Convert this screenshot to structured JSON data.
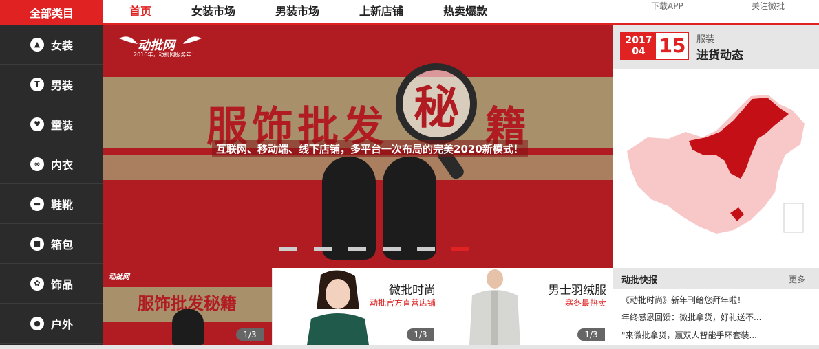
{
  "header": {
    "all_categories": "全部类目",
    "nav": [
      {
        "label": "首页",
        "active": true
      },
      {
        "label": "女装市场",
        "active": false
      },
      {
        "label": "男装市场",
        "active": false
      },
      {
        "label": "上新店铺",
        "active": false
      },
      {
        "label": "热卖爆款",
        "active": false
      }
    ],
    "download_app": "下载APP",
    "follow_weibo": "关注微批"
  },
  "sidebar": {
    "items": [
      {
        "label": "女装",
        "icon": "dress-icon"
      },
      {
        "label": "男装",
        "icon": "shirt-icon"
      },
      {
        "label": "童装",
        "icon": "kids-clothes-icon"
      },
      {
        "label": "内衣",
        "icon": "underwear-icon"
      },
      {
        "label": "鞋靴",
        "icon": "shoe-icon"
      },
      {
        "label": "箱包",
        "icon": "bag-icon"
      },
      {
        "label": "饰品",
        "icon": "accessory-icon"
      },
      {
        "label": "户外",
        "icon": "outdoor-icon"
      }
    ]
  },
  "banner": {
    "logo_text": "动批网",
    "logo_sub": "2016年，动批网服务年！",
    "headline": "服饰批发",
    "headline_magnified": "秘",
    "headline_tail": "籍",
    "subline": "互联网、移动端、线下店铺，多平台一次布局的完美2020新模式！",
    "slide_count": 6,
    "active_slide": 6
  },
  "date_panel": {
    "year": "2017",
    "month": "04",
    "day": "15",
    "category": "服装",
    "title": "进货动态"
  },
  "bottom_cards": [
    {
      "type": "banner",
      "headline": "服饰批发秘籍",
      "logo": "动批网",
      "pager": "1/3"
    },
    {
      "title": "微批时尚",
      "subtitle": "动批官方直营店铺",
      "pager": "1/3"
    },
    {
      "title": "男士羽绒服",
      "subtitle": "寒冬最热卖",
      "pager": "1/3"
    }
  ],
  "news": {
    "title": "动批快报",
    "more": "更多",
    "items": [
      "《动批时尚》新年刊给您拜年啦！",
      "年终感恩回馈：微批拿货，好礼送不...",
      "\"来微批拿货，赢双人智能手环套装..."
    ]
  },
  "colors": {
    "brand_red": "#e02222",
    "sidebar_bg": "#2b2b2b",
    "banner_red": "#b01c22"
  }
}
